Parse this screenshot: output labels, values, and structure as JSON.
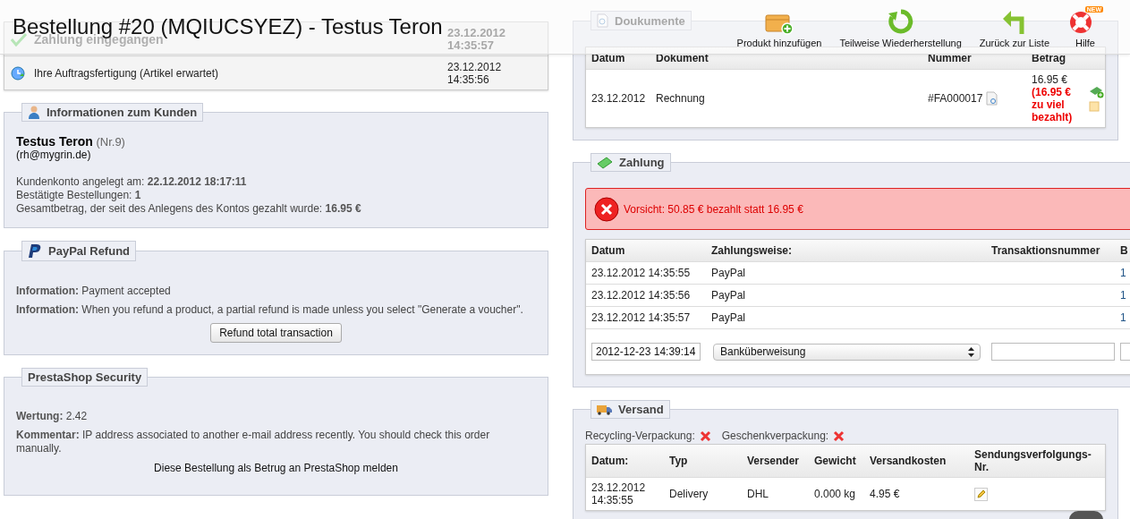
{
  "header": {
    "title": "Bestellung #20 (MQIUCSYEZ) - Testus Teron",
    "toolbar": [
      {
        "label": "Produkt hinzufügen",
        "kind": "add"
      },
      {
        "label": "Teilweise Wiederherstellung",
        "kind": "refresh"
      },
      {
        "label": "Zurück zur Liste",
        "kind": "back"
      },
      {
        "label": "Hilfe",
        "kind": "help",
        "badge": "NEW"
      }
    ]
  },
  "history": [
    {
      "label": "Zahlung eingegangen",
      "date": "23.12.2012",
      "time": "14:35:57",
      "kind": "done"
    },
    {
      "label": "Ihre Auftragsfertigung (Artikel erwartet)",
      "date": "23.12.2012",
      "time": "14:35:56",
      "kind": "waiting"
    }
  ],
  "customer": {
    "legend": "Informationen zum Kunden",
    "name": "**Testus Teron** (Nr.9)",
    "email": "(rh@mygrin.de)",
    "facts": [
      "Kundenkonto angelegt am: **22.12.2012 18:17:11**",
      "Bestätigte Bestellungen: **1**",
      "Gesamtbetrag, der seit des Anlegens des Kontos gezahlt wurde: **16.95 €**"
    ]
  },
  "paypal": {
    "legend": "PayPal Refund",
    "lines": [
      "**Information:** Payment accepted",
      "**Information:** When you refund a product, a partial refund is made unless you select \"Generate a voucher\"."
    ],
    "button": "Refund total transaction"
  },
  "security": {
    "legend": "PrestaShop Security",
    "lines": [
      "**Wertung:** 2.42",
      "**Kommentar:** IP address associated to another e-mail address recently. You should check this order manually."
    ],
    "link": "Diese Bestellung als Betrug an PrestaShop melden"
  },
  "documents": {
    "legend": "Doukumente",
    "columns": [
      "Datum",
      "Dokument",
      "Nummer",
      "Betrag"
    ],
    "rows": [
      {
        "date": "23.12.2012",
        "document": "Rechnung",
        "number": "#FA000017",
        "amount": "16.95 €",
        "warning": "(16.95 € zu viel bezahlt)"
      }
    ]
  },
  "payment": {
    "legend": "Zahlung",
    "alert": "Vorsicht: 50.85 € bezahlt statt 16.95 €",
    "columns": [
      "Datum",
      "Zahlungsweise:",
      "Transaktionsnummer",
      "B"
    ],
    "rows": [
      {
        "date": "23.12.2012 14:35:55",
        "method": "PayPal",
        "column_4": "1"
      },
      {
        "date": "23.12.2012 14:35:56",
        "method": "PayPal",
        "column_4": "1"
      },
      {
        "date": "23.12.2012 14:35:57",
        "method": "PayPal",
        "column_4": "1"
      }
    ],
    "form": {
      "date": "2012-12-23 14:39:14",
      "method": "Banküberweisung"
    }
  },
  "shipping": {
    "legend": "Versand",
    "options": [
      {
        "label": "Recycling-Verpackung:",
        "checked": false
      },
      {
        "label": "Geschenkverpackung:",
        "checked": false
      }
    ],
    "columns": [
      "Datum:",
      "Typ",
      "Versender",
      "Gewicht",
      "Versandkosten",
      "Sendungsverfolgungs-Nr."
    ],
    "rows": [
      {
        "date": "23.12.2012",
        "time": "14:35:55",
        "type": "Delivery",
        "carrier": "DHL",
        "weight": "0.000 kg",
        "cost": "4.95 €"
      }
    ]
  }
}
